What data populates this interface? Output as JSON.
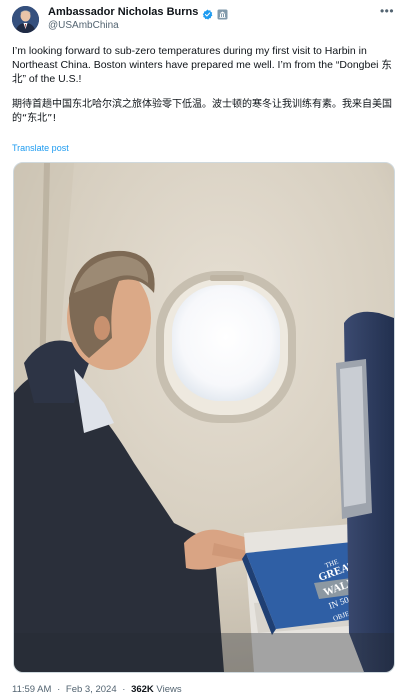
{
  "author": {
    "display_name": "Ambassador Nicholas Burns",
    "handle": "@USAmbChina"
  },
  "tweet": {
    "text_en": "I’m looking forward to sub-zero temperatures during my first visit to Harbin in Northeast China. Boston winters have prepared me well.  I’m from the “Dongbei 东北” of the U.S.!",
    "text_zh": "期待首趟中国东北哈尔滨之旅体验零下低温。波士顿的寒冬让我训练有素。我来自美国的“东北”!",
    "translate_label": "Translate post"
  },
  "book": {
    "title_lines": [
      "THE",
      "GREAT",
      "WALL",
      "IN 50",
      "OBJECTS"
    ]
  },
  "meta": {
    "time": "11:59 AM",
    "date": "Feb 3, 2024",
    "views_count": "362K",
    "views_label": "Views",
    "separator": "·"
  },
  "colors": {
    "link": "#1d9bf0",
    "secondary_text": "#536471",
    "verified": "#1d9bf0",
    "gov_badge": "#829aab"
  },
  "icons": {
    "verified": "verified-checkmark-icon",
    "government": "government-badge-icon",
    "more": "more-options-icon"
  }
}
